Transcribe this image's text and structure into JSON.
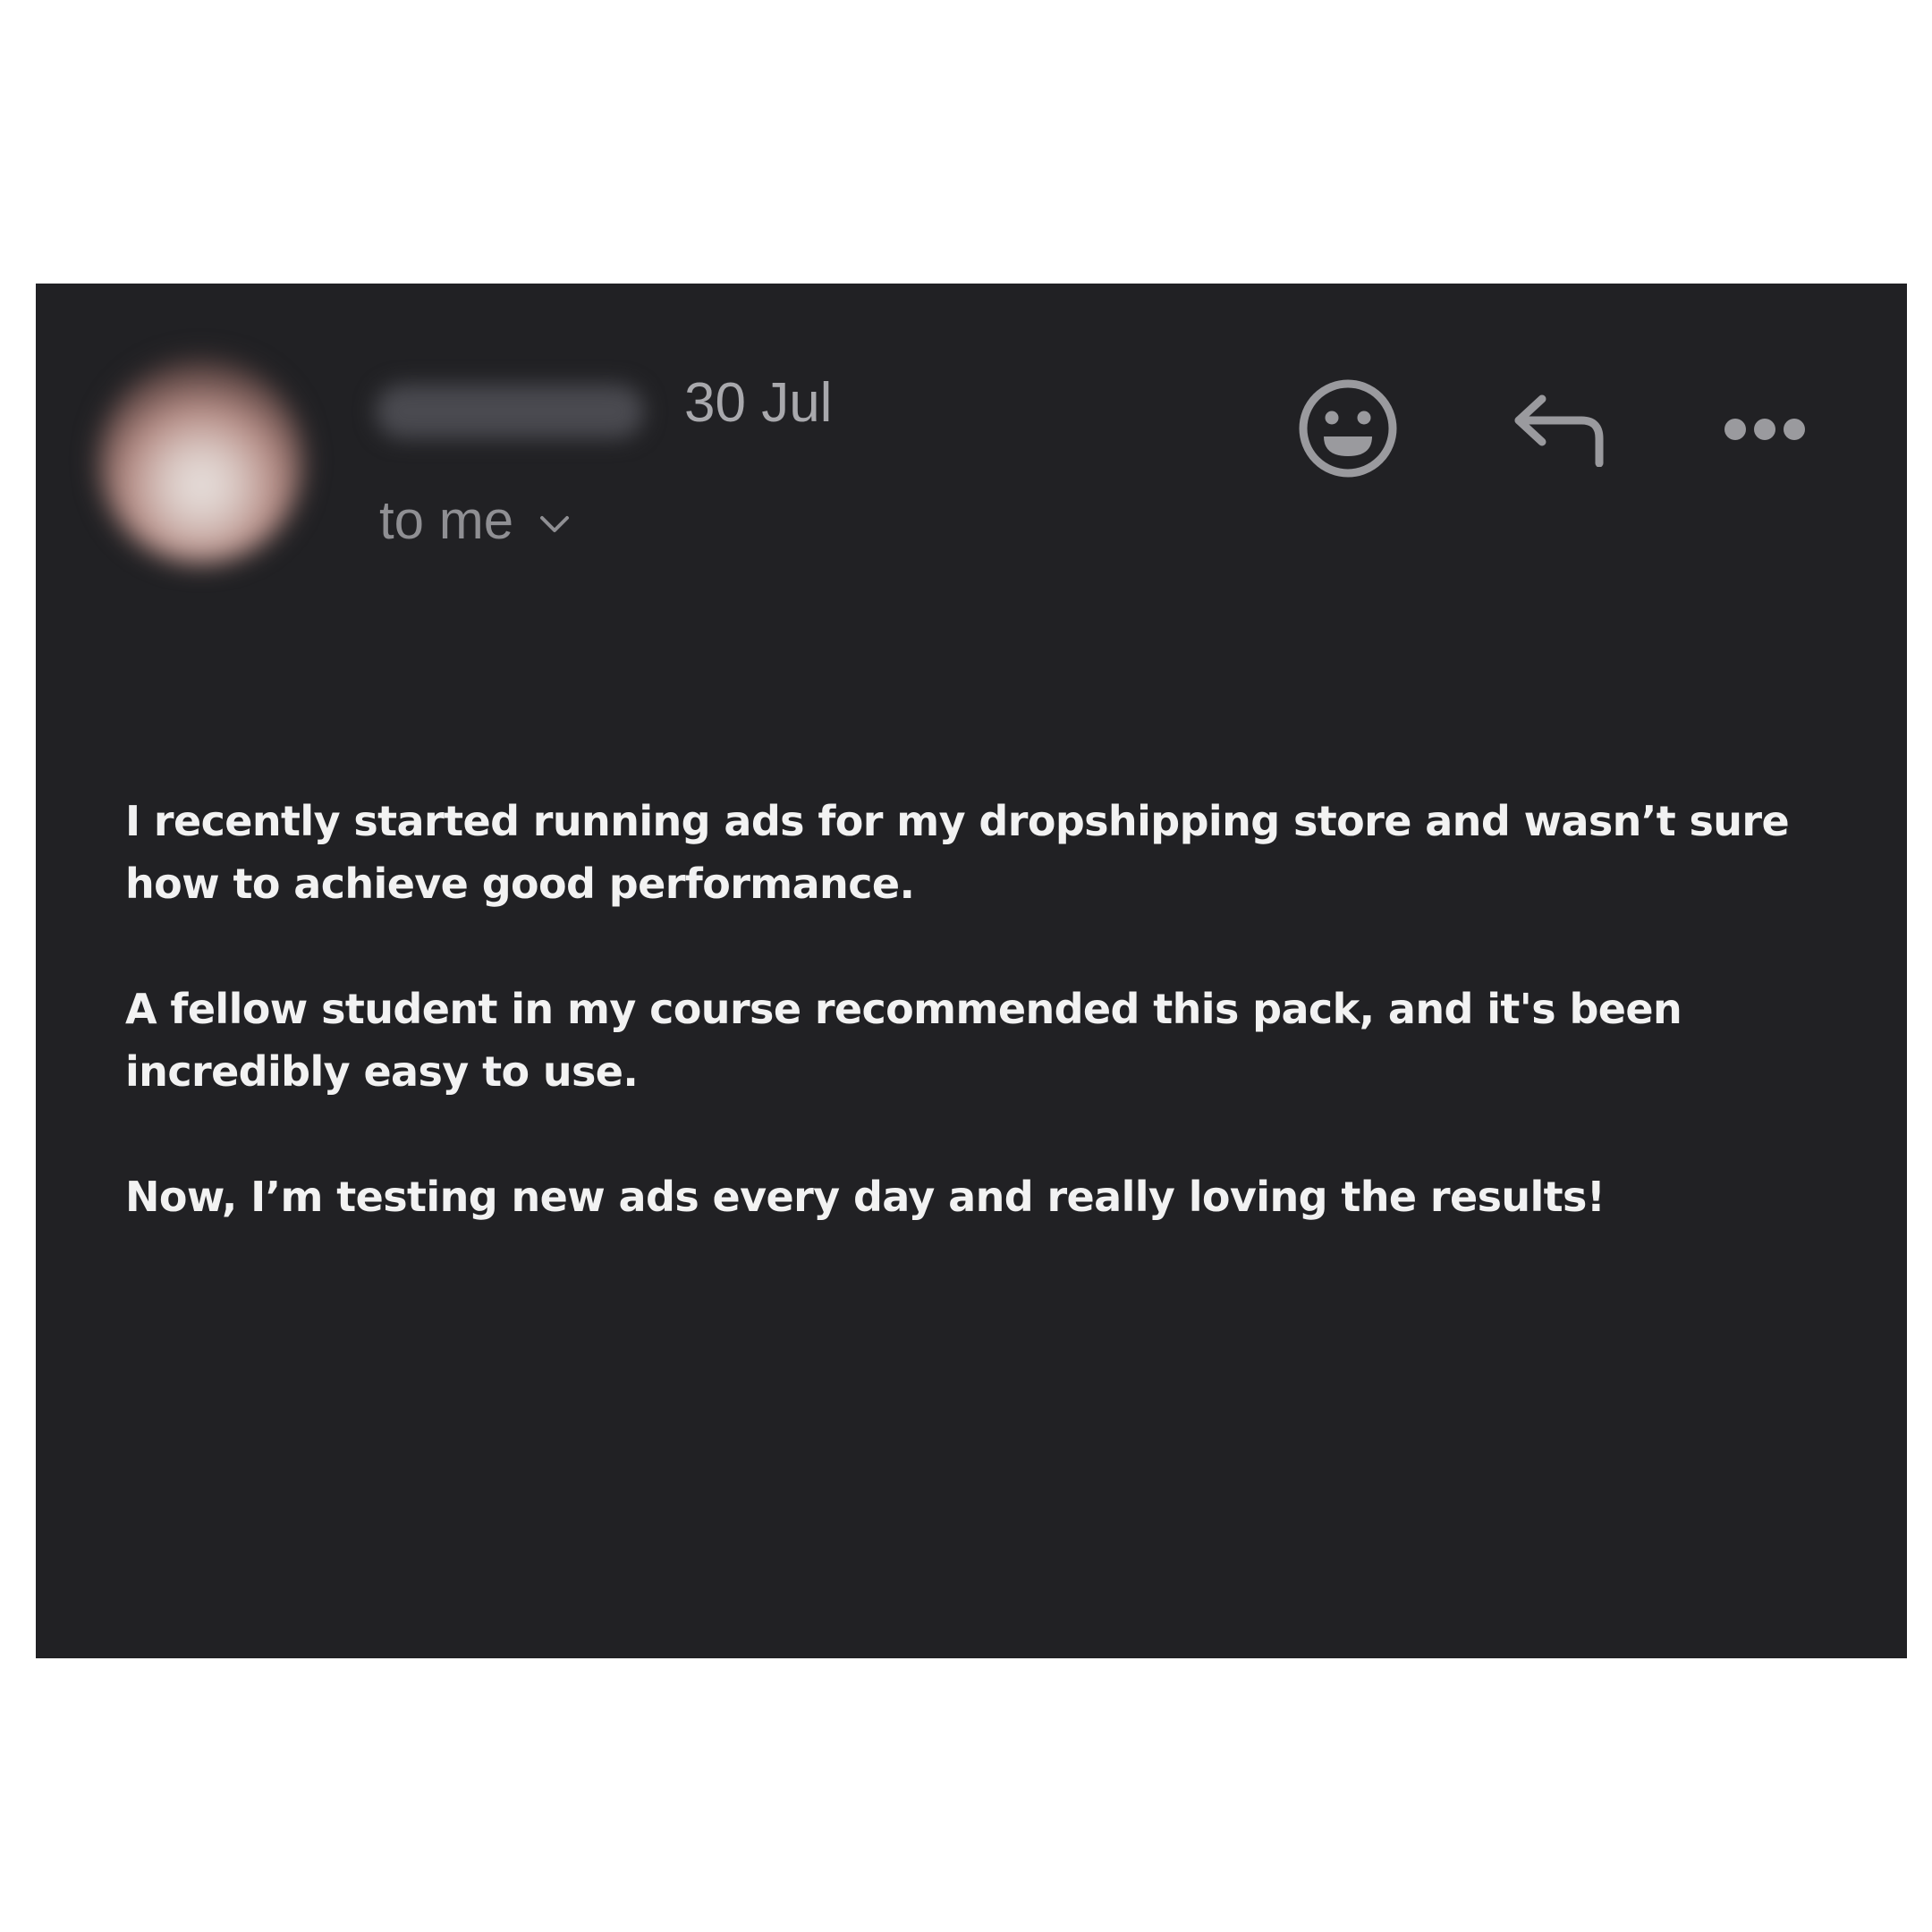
{
  "message": {
    "date": "30 Jul",
    "recipient_label": "to me",
    "paragraphs": [
      "I recently started running ads for my dropshipping store and wasn’t sure how to achieve good performance.",
      "A fellow student in my course recommended this pack, and it's been incredibly easy to use.",
      "Now, I’m testing new ads every day and really loving the results!"
    ]
  },
  "icons": {
    "recipient_toggle": "chevron-down-icon",
    "react": "smiley-icon",
    "reply": "reply-arrow-icon",
    "more": "more-options-icon"
  },
  "colors": {
    "page_background": "#ffffff",
    "card_background": "#212124",
    "body_text": "#f2f2f2",
    "meta_text": "#a9a9ad",
    "icon": "#9a9a9e"
  }
}
